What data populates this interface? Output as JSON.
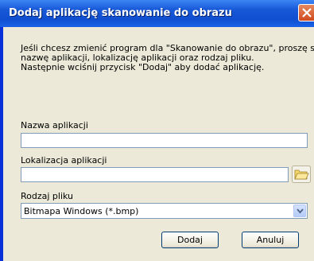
{
  "window": {
    "title": "Dodaj aplikację skanowanie do obrazu"
  },
  "instructions": {
    "line1": "Jeśli chcesz zmienić program dla \"Skanowanie do obrazu\", proszę sprecyzuj",
    "line2": "nazwę aplikacji, lokalizację aplikacji oraz rodzaj pliku.",
    "line3": "Następnie wciśnij przycisk \"Dodaj\" aby dodać aplikację."
  },
  "app_name": {
    "label": "Nazwa aplikacji",
    "value": ""
  },
  "app_location": {
    "label": "Lokalizacja aplikacji",
    "value": ""
  },
  "file_type": {
    "label": "Rodzaj pliku",
    "selected": "Bitmapa Windows (*.bmp)"
  },
  "buttons": {
    "add": "Dodaj",
    "cancel": "Anuluj"
  },
  "icons": {
    "close": "close-icon",
    "browse": "folder-icon",
    "dropdown": "chevron-down-icon"
  },
  "colors": {
    "titlebar": "#0f4fd0",
    "dialog_bg": "#ece9d8",
    "field_border": "#7f9db9"
  }
}
